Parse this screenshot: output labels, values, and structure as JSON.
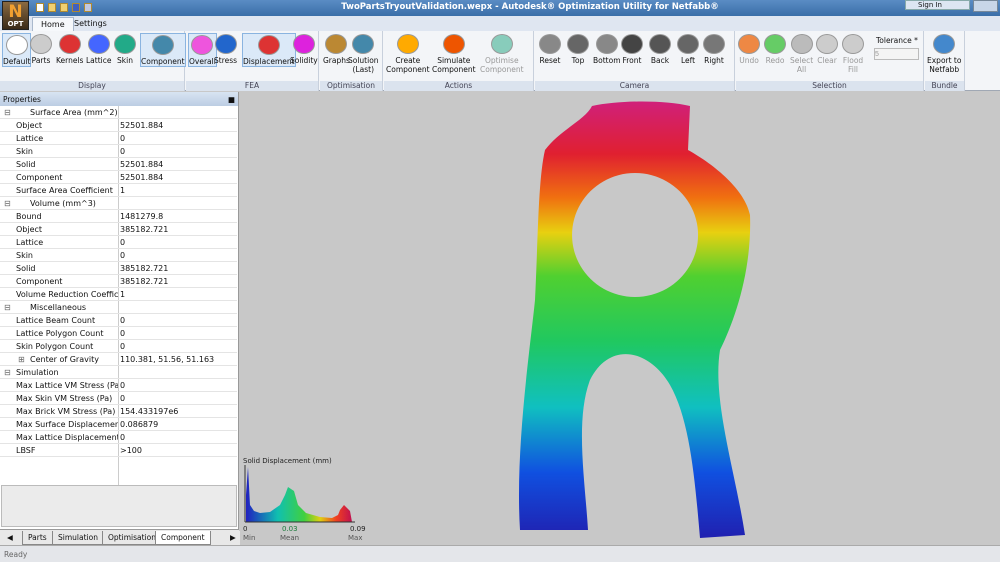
{
  "window": {
    "title": "TwoPartsTryoutValidation.wepx - Autodesk® Optimization Utility for Netfabb®",
    "app_logo": "N",
    "app_logo_sub": "OPT",
    "sign_in": "Sign In"
  },
  "tabs": [
    "Home",
    "Settings"
  ],
  "ribbon": {
    "display": {
      "label": "Display",
      "buttons": [
        "Default",
        "Parts",
        "Kernels",
        "Lattice",
        "Skin",
        "Component"
      ]
    },
    "fea": {
      "label": "FEA",
      "buttons": [
        "Overall",
        "Stress",
        "Displacement",
        "Solidity"
      ]
    },
    "optimisation": {
      "label": "Optimisation",
      "buttons": [
        "Graphs",
        "Solution\n(Last)"
      ]
    },
    "actions": {
      "label": "Actions",
      "buttons": [
        "Create\nComponent",
        "Simulate\nComponent",
        "Optimise\nComponent"
      ]
    },
    "camera": {
      "label": "Camera",
      "buttons": [
        "Reset",
        "Top",
        "Bottom",
        "Front",
        "Back",
        "Left",
        "Right"
      ]
    },
    "selection": {
      "label": "Selection",
      "buttons": [
        "Undo",
        "Redo",
        "Select\nAll",
        "Clear",
        "Flood\nFill"
      ],
      "tolerance_label": "Tolerance *",
      "tolerance_value": "5"
    },
    "bundle": {
      "label": "Bundle",
      "buttons": [
        "Export to\nNetfabb"
      ]
    }
  },
  "properties": {
    "title": "Properties",
    "rows": [
      {
        "k": "Surface Area (mm^2)",
        "v": "",
        "cat": true
      },
      {
        "k": "Object",
        "v": "52501.884"
      },
      {
        "k": "Lattice",
        "v": "0"
      },
      {
        "k": "Skin",
        "v": "0"
      },
      {
        "k": "Solid",
        "v": "52501.884"
      },
      {
        "k": "Component",
        "v": "52501.884"
      },
      {
        "k": "Surface Area Coefficient",
        "v": "1"
      },
      {
        "k": "Volume (mm^3)",
        "v": "",
        "cat": true
      },
      {
        "k": "Bound",
        "v": "1481279.8"
      },
      {
        "k": "Object",
        "v": "385182.721"
      },
      {
        "k": "Lattice",
        "v": "0"
      },
      {
        "k": "Skin",
        "v": "0"
      },
      {
        "k": "Solid",
        "v": "385182.721"
      },
      {
        "k": "Component",
        "v": "385182.721"
      },
      {
        "k": "Volume Reduction Coeffic...",
        "v": "1"
      },
      {
        "k": "Miscellaneous",
        "v": "",
        "cat": true
      },
      {
        "k": "Lattice Beam Count",
        "v": "0"
      },
      {
        "k": "Lattice Polygon Count",
        "v": "0"
      },
      {
        "k": "Skin Polygon Count",
        "v": "0"
      },
      {
        "k": "Center of Gravity",
        "v": "110.381, 51.56, 51.163",
        "expand": true
      },
      {
        "k": "Simulation",
        "v": "",
        "cat": true,
        "noicon": true
      },
      {
        "k": "Max Lattice VM Stress (Pa)",
        "v": "0"
      },
      {
        "k": "Max Skin VM Stress (Pa)",
        "v": "0"
      },
      {
        "k": "Max Brick VM Stress (Pa)",
        "v": "154.433197e6"
      },
      {
        "k": "Max Surface Displacemen...",
        "v": "0.086879"
      },
      {
        "k": "Max Lattice Displacement...",
        "v": "0"
      },
      {
        "k": "LBSF",
        "v": ">100"
      }
    ]
  },
  "bottom_tabs": [
    "Parts",
    "Simulation",
    "Optimisation",
    "Component"
  ],
  "active_bottom_tab": "Component",
  "status": "Ready",
  "legend": {
    "title": "Solid Displacement (mm)",
    "ticks": [
      "0",
      "0.03",
      "0.09"
    ],
    "tick_sub": [
      "Min",
      "Mean",
      "Max"
    ]
  }
}
